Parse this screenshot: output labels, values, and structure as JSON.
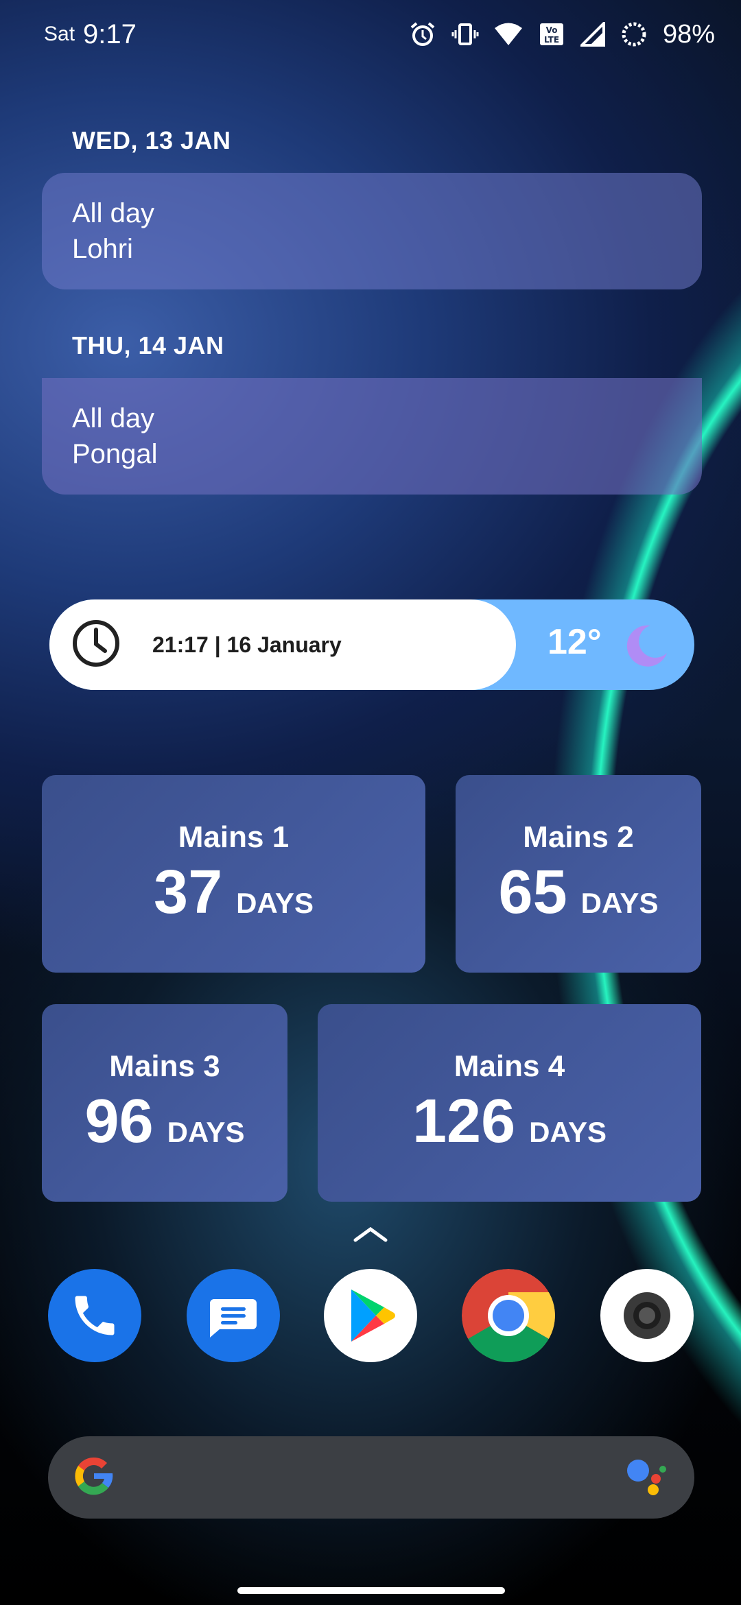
{
  "status_bar": {
    "day": "Sat",
    "time": "9:17",
    "battery": "98%",
    "icons": [
      "alarm-icon",
      "vibrate-icon",
      "wifi-icon",
      "volte-icon",
      "signal-icon",
      "battery-ring-icon"
    ]
  },
  "calendar": {
    "events": [
      {
        "date": "WED, 13 JAN",
        "line1": "All day",
        "line2": "Lohri"
      },
      {
        "date": "THU, 14 JAN",
        "line1": "All day",
        "line2": "Pongal"
      }
    ]
  },
  "clock_widget": {
    "time_date": "21:17 | 16 January",
    "temperature": "12°",
    "weather_icon": "moon-icon"
  },
  "countdowns": [
    {
      "title": "Mains 1",
      "number": "37",
      "unit": "DAYS"
    },
    {
      "title": "Mains 2",
      "number": "65",
      "unit": "DAYS"
    },
    {
      "title": "Mains 3",
      "number": "96",
      "unit": "DAYS"
    },
    {
      "title": "Mains 4",
      "number": "126",
      "unit": "DAYS"
    }
  ],
  "dock": {
    "apps": [
      "phone-icon",
      "messages-icon",
      "play-store-icon",
      "chrome-icon",
      "camera-icon"
    ]
  },
  "search_bar": {
    "left_icon": "google-g-icon",
    "right_icon": "google-assistant-icon"
  },
  "colors": {
    "event_card": "#6e78c8",
    "count_card": "#4a61a8",
    "weather_pill": "#6fb8ff",
    "search_bar": "#3c3f44"
  }
}
